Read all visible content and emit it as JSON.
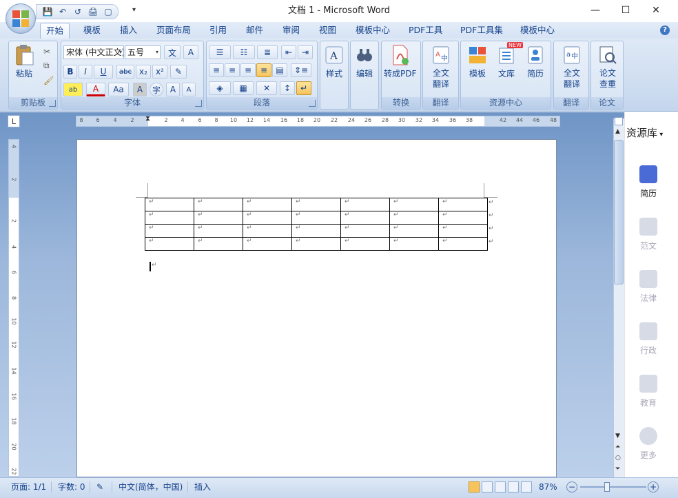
{
  "window": {
    "title": "文档 1 - Microsoft Word",
    "minimize": "—",
    "maximize": "☐",
    "close": "✕"
  },
  "qat": {
    "save": "💾",
    "undo": "↶",
    "redo": "↺",
    "print": "🖨",
    "preview": "▢",
    "more": "▾"
  },
  "tabs": [
    "开始",
    "模板",
    "插入",
    "页面布局",
    "引用",
    "邮件",
    "审阅",
    "视图",
    "模板中心",
    "PDF工具",
    "PDF工具集",
    "模板中心"
  ],
  "help": "?",
  "ribbon": {
    "clipboard": {
      "label": "剪贴板",
      "paste": "粘贴"
    },
    "font": {
      "label": "字体",
      "font_name": "宋体 (中文正文)",
      "font_size": "五号",
      "bold": "B",
      "italic": "I",
      "underline": "U",
      "strike": "abc",
      "sub": "x₂",
      "sup": "x²",
      "color": "A",
      "case": "Aa",
      "grow": "A",
      "shrink": "A"
    },
    "paragraph": {
      "label": "段落"
    },
    "styles": {
      "label": "样式"
    },
    "editing": {
      "label": "编辑"
    },
    "convert": {
      "label": "转换",
      "pdf": "转成PDF"
    },
    "translate1": {
      "label": "翻译",
      "full": "全文\n翻译"
    },
    "resources": {
      "label": "资源中心",
      "templates": "模板",
      "library": "文库",
      "resume": "简历",
      "new_badge": "NEW"
    },
    "translate2": {
      "label": "翻译",
      "full": "全文\n翻译"
    },
    "paper": {
      "label": "论文",
      "check": "论文\n查重"
    }
  },
  "rulers": {
    "h_ticks": [
      "8",
      "6",
      "4",
      "2",
      "2",
      "4",
      "6",
      "8",
      "10",
      "12",
      "14",
      "16",
      "18",
      "20",
      "22",
      "24",
      "26",
      "28",
      "30",
      "32",
      "34",
      "36",
      "38",
      "42",
      "44",
      "46",
      "48"
    ],
    "v_ticks": [
      "4",
      "2",
      "2",
      "4",
      "6",
      "8",
      "10",
      "12",
      "14",
      "16",
      "18",
      "20",
      "22"
    ]
  },
  "table": {
    "rows": 4,
    "cols": 7,
    "cell_mark": "↵"
  },
  "side_panel": {
    "title": "资源库",
    "items": [
      {
        "label": "简历",
        "active": true
      },
      {
        "label": "范文",
        "active": false
      },
      {
        "label": "法律",
        "active": false
      },
      {
        "label": "行政",
        "active": false
      },
      {
        "label": "教育",
        "active": false
      },
      {
        "label": "更多",
        "active": false
      }
    ]
  },
  "status": {
    "page": "页面: 1/1",
    "words": "字数: 0",
    "language": "中文(简体，中国)",
    "mode": "插入",
    "zoom": "87%",
    "zoom_out": "−",
    "zoom_in": "+"
  },
  "colors": {
    "ribbon": "#d6e3f4",
    "doc_bg": "#9cb7db",
    "accent": "#4a6bd6"
  }
}
